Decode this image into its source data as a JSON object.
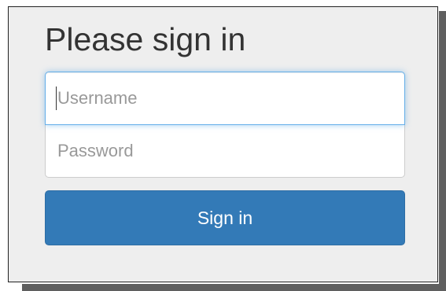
{
  "form": {
    "heading": "Please sign in",
    "username": {
      "placeholder": "Username",
      "value": ""
    },
    "password": {
      "placeholder": "Password",
      "value": ""
    },
    "submit_label": "Sign in"
  },
  "colors": {
    "primary": "#337ab7",
    "focus_border": "#66afe9",
    "panel_background": "#eeeeee",
    "heading_text": "#333333"
  }
}
